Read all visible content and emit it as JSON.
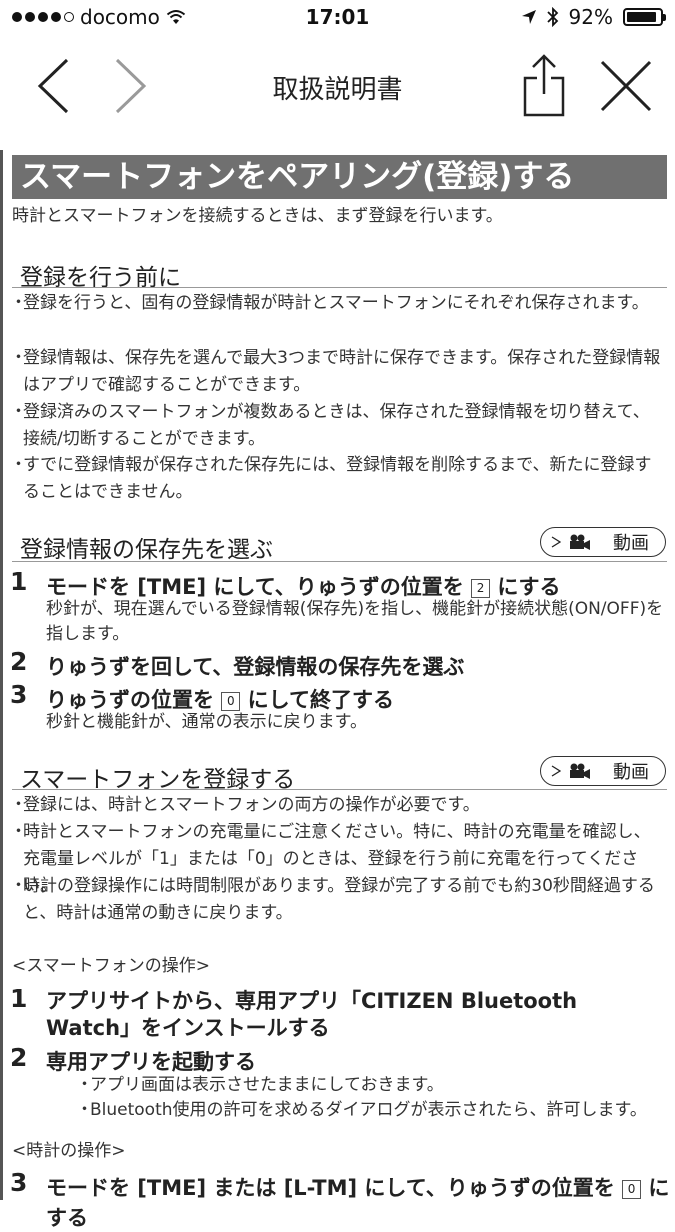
{
  "status": {
    "carrier": "docomo",
    "time": "17:01",
    "battery": "92%",
    "battery_level": 0.92
  },
  "nav": {
    "title": "取扱説明書"
  },
  "banner": "スマートフォンをペアリング(登録)する",
  "intro": "時計とスマートフォンを接続するときは、まず登録を行います。",
  "sec1": {
    "heading": "登録を行う前に",
    "bullets": [
      "登録を行うと、固有の登録情報が時計とスマートフォンにそれぞれ保存されます。",
      "登録情報は、保存先を選んで最大3つまで時計に保存できます。保存された登録情報はアプリで確認することができます。",
      "登録済みのスマートフォンが複数あるときは、保存された登録情報を切り替えて、接続/切断することができます。",
      "すでに登録情報が保存された保存先には、登録情報を削除するまで、新たに登録することはできません。"
    ]
  },
  "sec2": {
    "heading": "登録情報の保存先を選ぶ",
    "video_label": "動画",
    "steps": [
      {
        "num": "1",
        "pre": "モードを [TME] にして、りゅうずの位置を",
        "badge": "2",
        "post": "にする",
        "desc": "秒針が、現在選んでいる登録情報(保存先)を指し、機能針が接続状態(ON/OFF)を指します。"
      },
      {
        "num": "2",
        "title": "りゅうずを回して、登録情報の保存先を選ぶ"
      },
      {
        "num": "3",
        "pre": "りゅうずの位置を",
        "badge": "0",
        "post": "にして終了する",
        "desc": "秒針と機能針が、通常の表示に戻ります。"
      }
    ]
  },
  "sec3": {
    "heading": "スマートフォンを登録する",
    "video_label": "動画",
    "bullets": [
      "登録には、時計とスマートフォンの両方の操作が必要です。",
      "時計とスマートフォンの充電量にご注意ください。特に、時計の充電量を確認し、充電量レベルが「1」または「0」のときは、登録を行う前に充電を行ってください。",
      "時計の登録操作には時間制限があります。登録が完了する前でも約30秒間経過すると、時計は通常の動きに戻ります。"
    ],
    "phone_ops_label": "<スマートフォンの操作>",
    "phone_steps": [
      {
        "num": "1",
        "title": "アプリサイトから、専用アプリ「CITIZEN Bluetooth Watch」をインストールする"
      },
      {
        "num": "2",
        "title": "専用アプリを起動する",
        "subs": [
          "アプリ画面は表示させたままにしておきます。",
          "Bluetooth使用の許可を求めるダイアログが表示されたら、許可します。"
        ]
      }
    ],
    "watch_ops_label": "<時計の操作>",
    "watch_step": {
      "num": "3",
      "pre": "モードを [TME] または [L-TM] にして、りゅうずの位置を",
      "badge": "0",
      "post": "にする"
    }
  }
}
